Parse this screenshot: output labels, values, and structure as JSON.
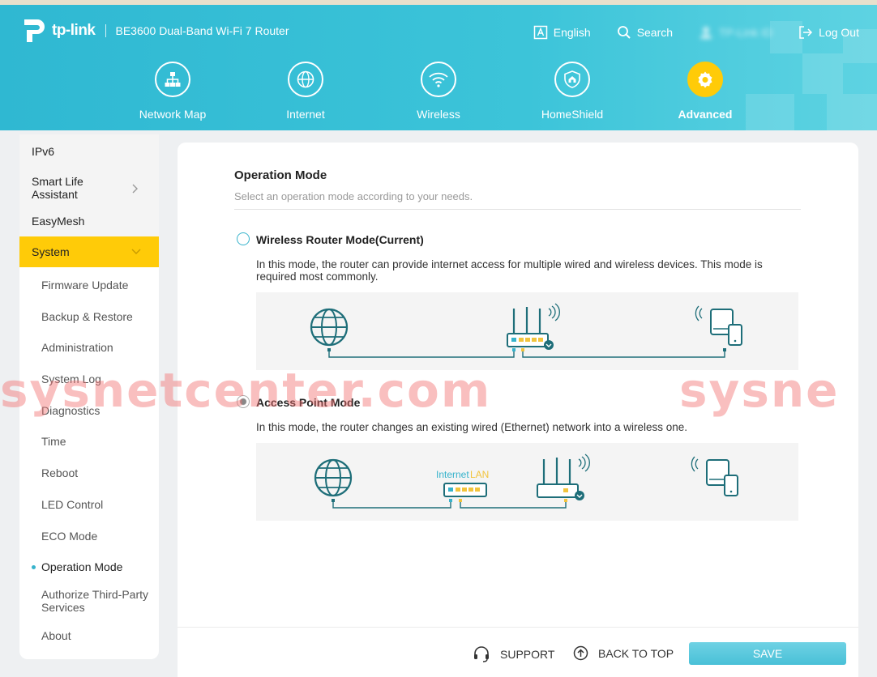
{
  "brand": {
    "logo_text": "tp-link",
    "model": "BE3600 Dual-Band Wi-Fi 7 Router"
  },
  "header_links": {
    "language": "English",
    "search": "Search",
    "account": "TP-Link ID",
    "logout": "Log Out"
  },
  "nav": [
    {
      "label": "Network Map",
      "icon": "network-map-icon"
    },
    {
      "label": "Internet",
      "icon": "globe-icon"
    },
    {
      "label": "Wireless",
      "icon": "wifi-icon"
    },
    {
      "label": "HomeShield",
      "icon": "shield-home-icon"
    },
    {
      "label": "Advanced",
      "icon": "gear-icon",
      "active": true
    }
  ],
  "sidebar": {
    "ipv6": "IPv6",
    "smart_life": "Smart Life Assistant",
    "easymesh": "EasyMesh",
    "system": "System",
    "sub": [
      "Firmware Update",
      "Backup & Restore",
      "Administration",
      "System Log",
      "Diagnostics",
      "Time",
      "Reboot",
      "LED Control",
      "ECO Mode",
      "Operation Mode",
      "Authorize Third-Party Services",
      "About"
    ],
    "active_sub": "Operation Mode"
  },
  "content": {
    "title": "Operation Mode",
    "subtitle": "Select an operation mode according to your needs.",
    "modes": [
      {
        "label": "Wireless Router Mode(Current)",
        "desc": "In this mode, the router can provide internet access for multiple wired and wireless devices. This mode is required most commonly.",
        "selected": false
      },
      {
        "label": "Access Point Mode",
        "desc": "In this mode, the router changes an existing wired (Ethernet) network into a wireless one.",
        "selected": true
      }
    ],
    "diagram_labels": {
      "internet": "Internet",
      "lan": "LAN"
    }
  },
  "footer": {
    "support": "SUPPORT",
    "back_to_top": "BACK TO TOP",
    "save": "SAVE"
  },
  "watermark": {
    "left": "sysnetcenter.com",
    "right": "sysne"
  },
  "colors": {
    "accent": "#37b3cc",
    "header": "#3cc4d9",
    "active_yellow": "#ffcb08",
    "diagram_teal": "#1e6e79",
    "diagram_yellow": "#f2c43d"
  }
}
